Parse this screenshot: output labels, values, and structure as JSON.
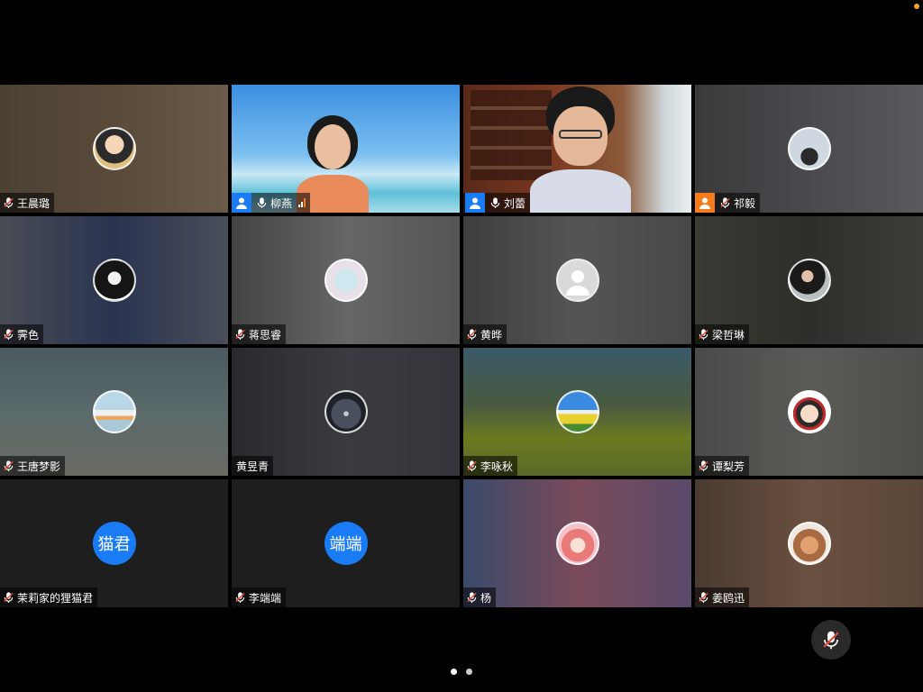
{
  "participants": [
    {
      "name": "王晨璐",
      "muted": true
    },
    {
      "name": "柳燕",
      "muted": false
    },
    {
      "name": "刘蕾",
      "muted": false
    },
    {
      "name": "祁毅",
      "muted": true
    },
    {
      "name": "霁色",
      "muted": true
    },
    {
      "name": "蒋思睿",
      "muted": true
    },
    {
      "name": "黄晔",
      "muted": true
    },
    {
      "name": "梁哲琳",
      "muted": true
    },
    {
      "name": "王唐梦影",
      "muted": true
    },
    {
      "name": "黄昱青",
      "muted": false
    },
    {
      "name": "李咏秋",
      "muted": true
    },
    {
      "name": "谭梨芳",
      "muted": true
    },
    {
      "name": "茉莉家的狸猫君",
      "muted": true,
      "avatar_text": "猫君"
    },
    {
      "name": "李端端",
      "muted": true,
      "avatar_text": "端端"
    },
    {
      "name": "杨",
      "muted": true
    },
    {
      "name": "姜鸥迅",
      "muted": true
    }
  ],
  "colors": {
    "speaking_border": "#2ecc40",
    "host_badge_blue": "#1a7cf5",
    "cohost_badge_orange": "#f57c1a",
    "text_avatar": "#1a7cf5",
    "status_dot": "#f5a623"
  },
  "pager": {
    "pages": 2,
    "active": 0
  },
  "icons": {
    "muted": "mic-muted-icon",
    "mic": "mic-icon",
    "host": "person-icon",
    "signal": "signal-icon",
    "self_mute": "mic-muted-icon"
  }
}
